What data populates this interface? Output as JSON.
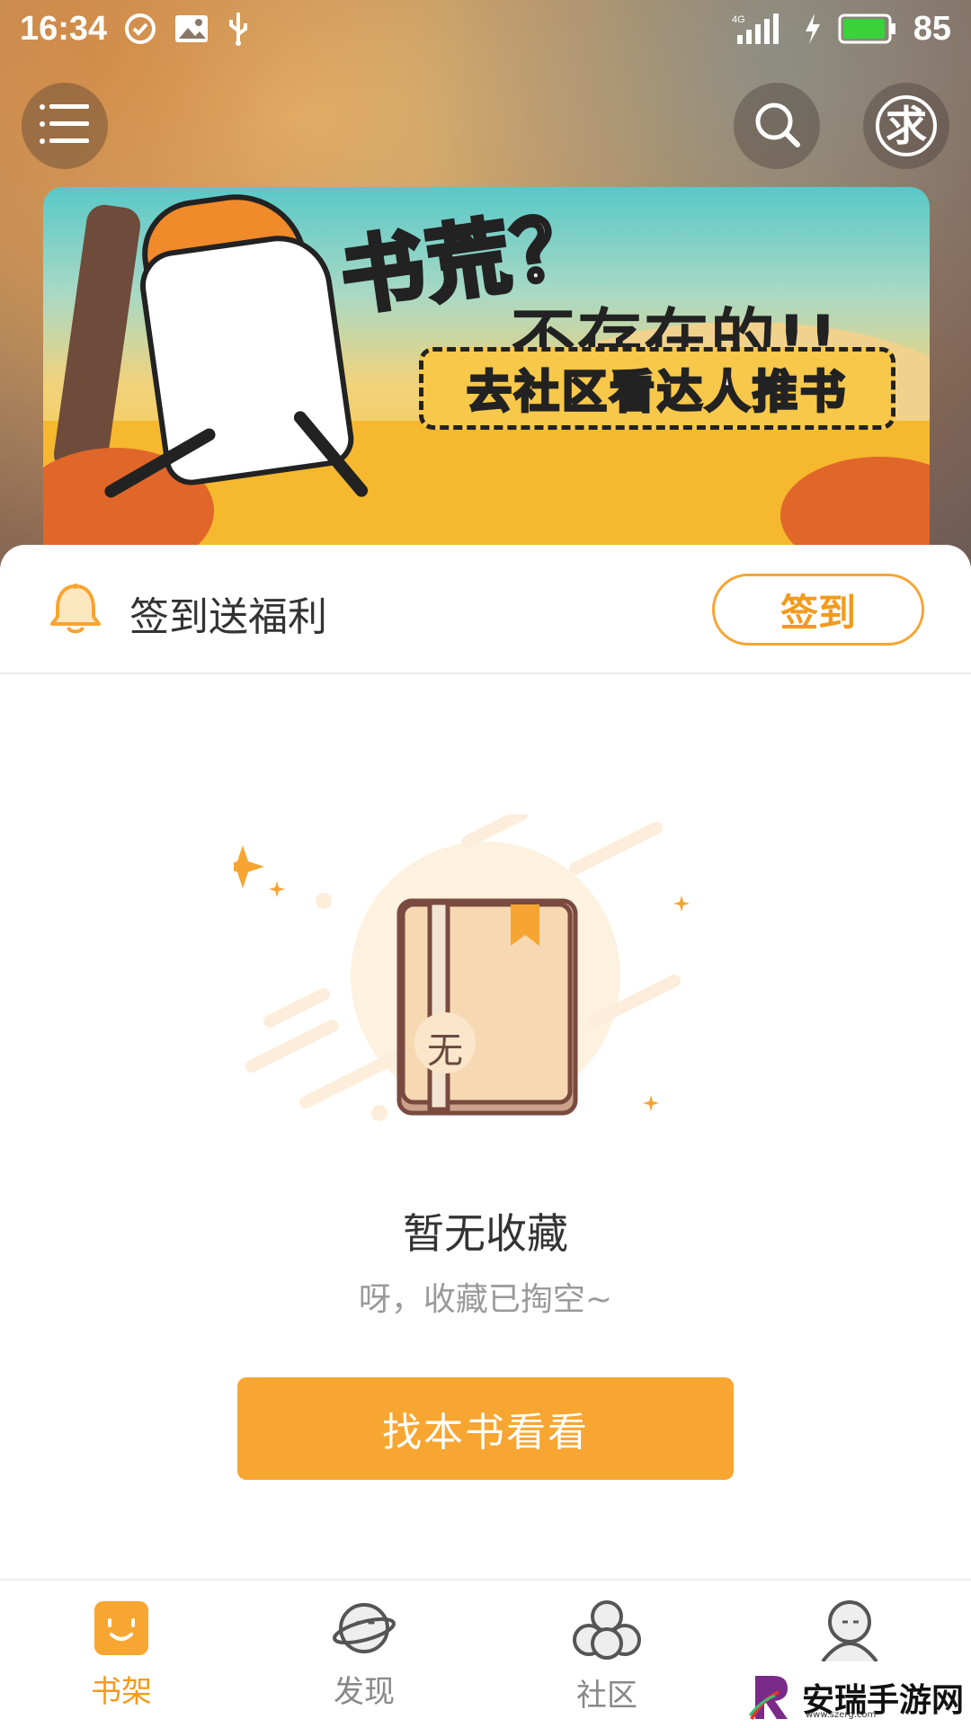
{
  "status_bar": {
    "time": "16:34",
    "network": "4G",
    "battery": "85",
    "icons": [
      "check-circle-icon",
      "image-icon",
      "usb-icon",
      "signal-icon",
      "charging-icon",
      "battery-icon"
    ]
  },
  "header": {
    "menu_icon": "menu-icon",
    "search_icon": "search-icon",
    "beg_label": "求"
  },
  "banner": {
    "title": "书荒？",
    "subtitle": "不存在的!!",
    "cta": "去社区看达人推书"
  },
  "checkin": {
    "label": "签到送福利",
    "button": "签到",
    "icon": "bell-icon"
  },
  "empty_state": {
    "book_badge": "无",
    "title": "暂无收藏",
    "subtitle": "呀，收藏已掏空~",
    "button": "找本书看看"
  },
  "tabs": [
    {
      "label": "书架",
      "icon": "bookshelf-icon",
      "active": true
    },
    {
      "label": "发现",
      "icon": "planet-icon",
      "active": false
    },
    {
      "label": "社区",
      "icon": "community-icon",
      "active": false
    },
    {
      "label": "",
      "icon": "profile-icon",
      "active": false
    }
  ],
  "watermark": {
    "text": "安瑞手游网",
    "url": "www.szerg.com"
  },
  "colors": {
    "accent": "#f7a632",
    "accent_text": "#f39a1e",
    "tab_inactive": "#888888"
  }
}
